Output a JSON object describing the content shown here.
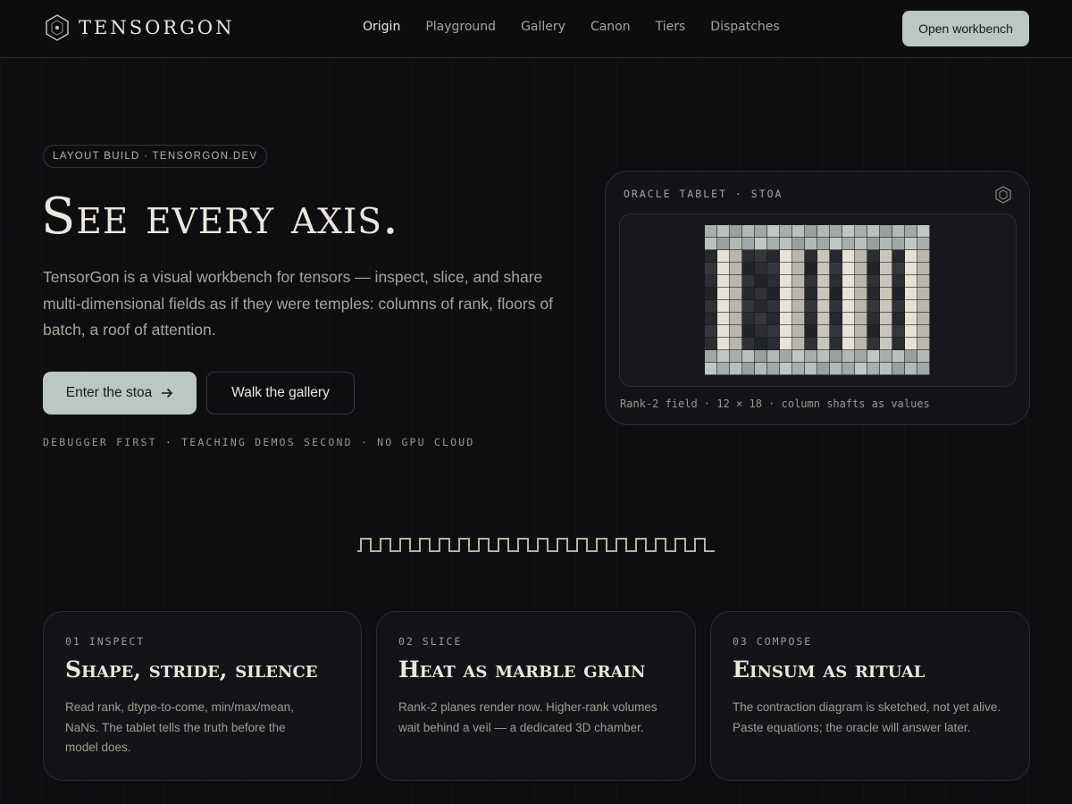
{
  "brand": {
    "name": "TENSORGON"
  },
  "nav": {
    "links": [
      {
        "label": "Origin",
        "active": true
      },
      {
        "label": "Playground",
        "active": false
      },
      {
        "label": "Gallery",
        "active": false
      },
      {
        "label": "Canon",
        "active": false
      },
      {
        "label": "Tiers",
        "active": false
      },
      {
        "label": "Dispatches",
        "active": false
      }
    ],
    "cta": "Open workbench"
  },
  "hero": {
    "badge": "LAYOUT BUILD · TENSORGON.DEV",
    "title": "See every axis.",
    "subtitle": "TensorGon is a visual workbench for tensors — inspect, slice, and share multi-dimensional fields as if they were temples: columns of rank, floors of batch, a roof of attention.",
    "primary_button": "Enter the stoa",
    "primary_icon": "arrow-right-icon",
    "secondary_button": "Walk the gallery",
    "tagline": "DEBUGGER FIRST · TEACHING DEMOS SECOND · NO GPU CLOUD"
  },
  "tablet": {
    "label": "ORACLE TABLET · STOA",
    "icon": "hexagon-icon",
    "caption": "Rank-2 field · 12 × 18 · column shafts as values"
  },
  "cards": [
    {
      "kicker": "01 INSPECT",
      "title": "Shape, stride, silence",
      "body": "Read rank, dtype-to-come, min/max/mean, NaNs. The tablet tells the truth before the model does."
    },
    {
      "kicker": "02 SLICE",
      "title": "Heat as marble grain",
      "body": "Rank-2 planes render now. Higher-rank volumes wait behind a veil — a dedicated 3D chamber."
    },
    {
      "kicker": "03 COMPOSE",
      "title": "Einsum as ritual",
      "body": "The contraction diagram is sketched, not yet alive. Paste equations; the oracle will answer later."
    }
  ],
  "colors": {
    "background": "#0e0e11",
    "accent": "#bcc6c2",
    "text": "#ebe7de",
    "muted": "#a9a59d",
    "meander": "#b9b0a2"
  }
}
